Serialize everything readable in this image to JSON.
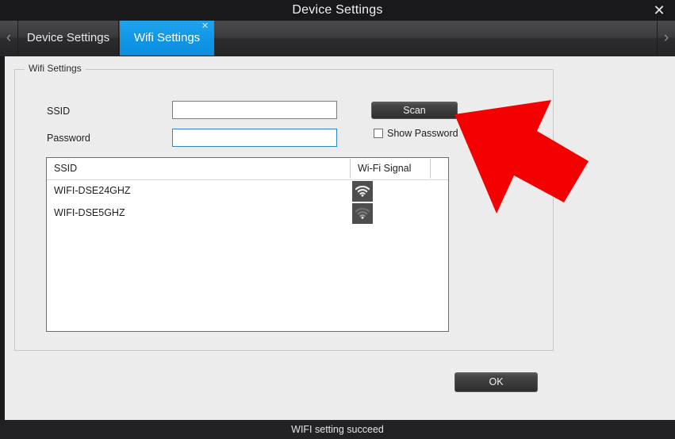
{
  "window": {
    "title": "Device Settings",
    "close_icon": "close-icon",
    "close_glyph": "✕"
  },
  "tabs": {
    "prev_glyph": "‹",
    "next_glyph": "›",
    "items": [
      {
        "label": "Device Settings",
        "active": false,
        "closable": false
      },
      {
        "label": "Wifi Settings",
        "active": true,
        "closable": true,
        "close_glyph": "✕"
      }
    ]
  },
  "groupbox": {
    "title": "Wifi Settings"
  },
  "form": {
    "ssid_label": "SSID",
    "ssid_value": "",
    "ssid_placeholder": "",
    "password_label": "Password",
    "password_value": "",
    "password_placeholder": "",
    "scan_button": "Scan",
    "show_password_label": "Show Password",
    "show_password_checked": false
  },
  "network_list": {
    "columns": [
      "SSID",
      "Wi-Fi Signal"
    ],
    "rows": [
      {
        "ssid": "WIFI-DSE24GHZ",
        "signal_icon": "wifi-signal-strong-icon",
        "bars": 3
      },
      {
        "ssid": "WIFI-DSE5GHZ",
        "signal_icon": "wifi-signal-weak-icon",
        "bars": 1
      }
    ]
  },
  "footer": {
    "ok_button": "OK"
  },
  "statusbar": {
    "message": "WIFI setting succeed"
  },
  "annotation": {
    "type": "arrow",
    "color": "#f40000",
    "points_to": "scan-button"
  },
  "colors": {
    "titlebar_bg": "#19191b",
    "active_tab": "#0f96e6",
    "panel_bg": "#ececec",
    "statusbar_bg": "#212126",
    "focus_border": "#2e86c8",
    "arrow_red": "#f40000"
  }
}
